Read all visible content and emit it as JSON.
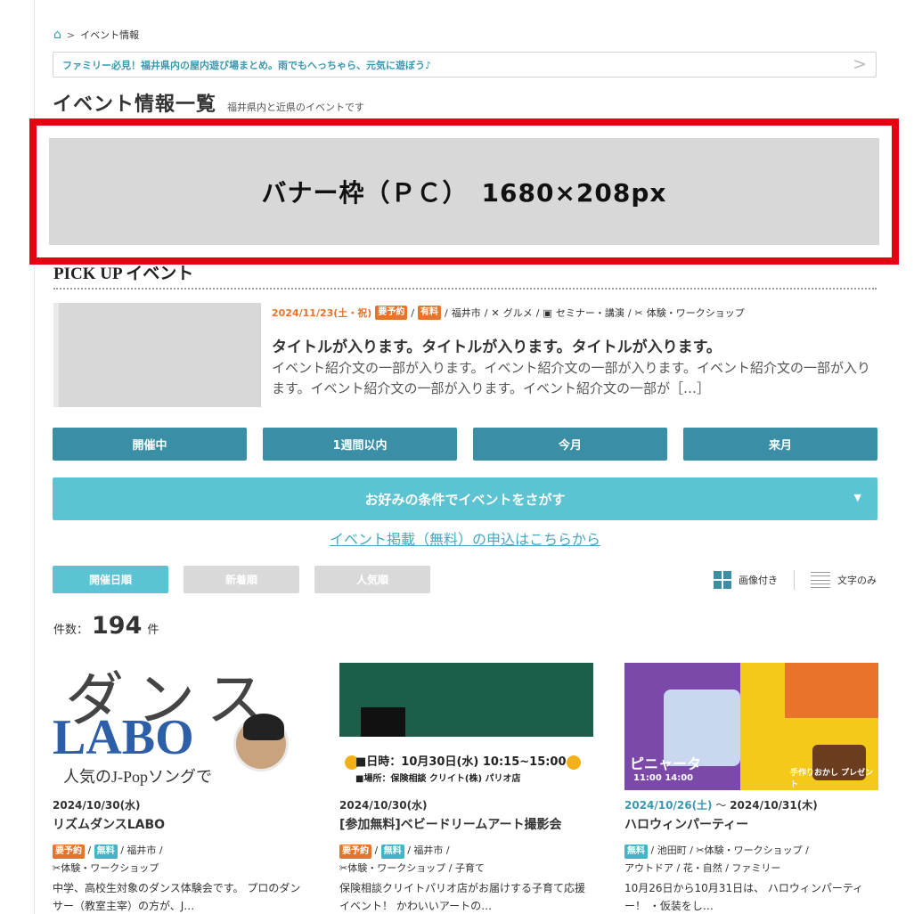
{
  "breadcrumb": {
    "home_icon": "home-icon",
    "separator": ">",
    "current": "イベント情報"
  },
  "notice": {
    "text": "ファミリー必見！福井県内の屋内遊び場まとめ。雨でもへっちゃら、元気に遊ぼう♪",
    "chevron": ">"
  },
  "page": {
    "title": "イベント情報一覧",
    "subtitle": "福井県内と近県のイベントです"
  },
  "banner": {
    "text": "バナー枠（ＰＣ）　1680×208px",
    "border_color": "#e60012"
  },
  "pickup": {
    "heading": "PICK UP イベント",
    "date": "2024/11/23(土・祝)",
    "badges": [
      "要予約",
      "有料"
    ],
    "area": "福井市",
    "categories": [
      "グルメ",
      "セミナー・講演",
      "体験・ワークショップ"
    ],
    "title": "タイトルが入ります。タイトルが入ります。タイトルが入ります。",
    "description": "イベント紹介文の一部が入ります。イベント紹介文の一部が入ります。イベント紹介文の一部が入ります。イベント紹介文の一部が入ります。イベント紹介文の一部が［…］"
  },
  "period_tabs": [
    "開催中",
    "1週間以内",
    "今月",
    "来月"
  ],
  "search": {
    "label": "お好みの条件でイベントをさがす",
    "arrow": "▼"
  },
  "apply_link": "イベント掲載（無料）の申込はこちらから",
  "sort": {
    "options": [
      "開催日順",
      "新着順",
      "人気順"
    ],
    "active": "開催日順"
  },
  "view": {
    "with_images": "画像付き",
    "text_only": "文字のみ"
  },
  "count": {
    "prefix": "件数：",
    "value": "194",
    "unit": "件"
  },
  "cards": [
    {
      "date": "2024/10/30(水)",
      "title": "リズムダンスLABO",
      "badges": [
        "要予約",
        "無料"
      ],
      "area": "福井市 /",
      "tags_line2": "体験・ワークショップ",
      "description": "中学、高校生対象のダンス体験会です。 プロのダンサー（教室主宰）の方が、J…",
      "image_text": {
        "big": "ダンス",
        "labo": "LABO",
        "sub": "人気のJ-Popソングで"
      }
    },
    {
      "date": "2024/10/30(水)",
      "title": "[参加無料]ベビードリームアート撮影会",
      "badges": [
        "要予約",
        "無料"
      ],
      "area": "福井市 /",
      "tags_line2": "体験・ワークショップ / 子育て",
      "description": "保険相談クリイトパリオ店がお届けする子育て応援イベント！ かわいいアートの…",
      "image_text": {
        "info": "■日時：10月30日(水) 10:15~15:00",
        "place": "■場所：保険相談 クリイト(株) パリオ店"
      }
    },
    {
      "date_start": "2024/10/26(土)",
      "date_sep": " ～ ",
      "date_end": "2024/10/31(木)",
      "title": "ハロウィンパーティー",
      "badges": [
        "無料"
      ],
      "area": "池田町 / ",
      "tags_line1_rest": "体験・ワークショップ /",
      "tags_line2": "アウトドア / 花・自然 / ファミリー",
      "description": "10月26日から10月31日は、 ハロウィンパーティー！ ・仮装をし…",
      "image_text": {
        "pinata": "ピニャータ",
        "cake": "手作りおかし プレゼント",
        "time": "11:00 14:00"
      }
    }
  ],
  "colors": {
    "accent": "#3a8fa6",
    "accent_light": "#5bc3d2",
    "badge_orange": "#e8742b",
    "badge_blue": "#44b4c8"
  }
}
